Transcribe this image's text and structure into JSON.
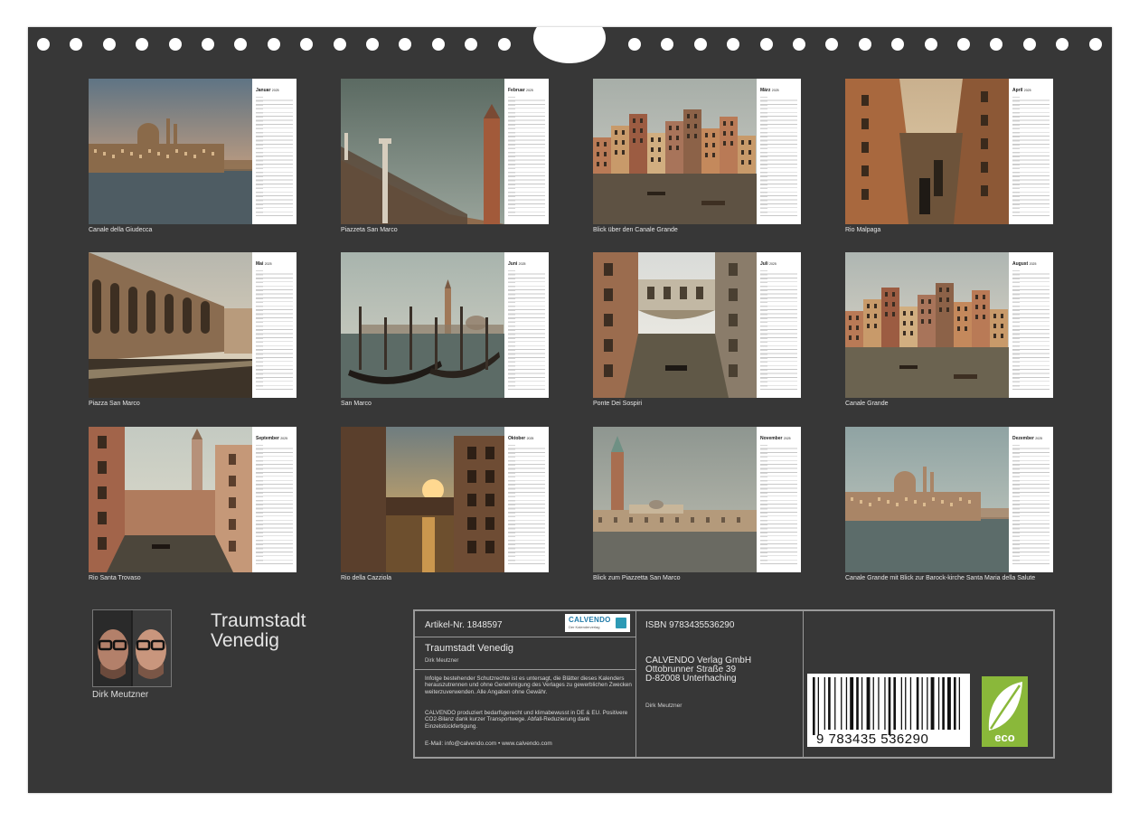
{
  "months": [
    {
      "name": "Januar",
      "year": "2025",
      "caption": "Canale della Giudecca",
      "scene": "domes-skyline",
      "palette": {
        "sky_top": "#5f7484",
        "sky_bottom": "#f2b27e",
        "main": "#8a6a4a",
        "water": "#4e5c63"
      }
    },
    {
      "name": "Februar",
      "year": "2025",
      "caption": "Piazzeta San Marco",
      "scene": "tower-column",
      "palette": {
        "sky_top": "#5b6a62",
        "sky_bottom": "#98a39a",
        "main": "#8f6b4d",
        "water": "#4f4a40"
      }
    },
    {
      "name": "März",
      "year": "2025",
      "caption": "Blick über den Canale Grande",
      "scene": "canal-wide",
      "palette": {
        "sky_top": "#a7aea8",
        "sky_bottom": "#cfcfc7",
        "main": "#b0724e",
        "water": "#5e5243"
      }
    },
    {
      "name": "April",
      "year": "2025",
      "caption": "Rio Malpaga",
      "scene": "narrow-canal",
      "palette": {
        "sky_top": "#c9b08e",
        "sky_bottom": "#e3cfaa",
        "main": "#a8683e",
        "water": "#6d533a"
      }
    },
    {
      "name": "Mai",
      "year": "2025",
      "caption": "Piazza San Marco",
      "scene": "arcade",
      "palette": {
        "sky_top": "#b7b7ae",
        "sky_bottom": "#e5d6bd",
        "main": "#8a6c50",
        "water": "#3d3328"
      }
    },
    {
      "name": "Juni",
      "year": "2025",
      "caption": "San Marco",
      "scene": "gondolas",
      "palette": {
        "sky_top": "#a8b4ad",
        "sky_bottom": "#d5d3c6",
        "main": "#7f6a55",
        "water": "#5c6b66"
      }
    },
    {
      "name": "Juli",
      "year": "2025",
      "caption": "Ponte Dei Sospiri",
      "scene": "bridge",
      "palette": {
        "sky_top": "#d9dbd8",
        "sky_bottom": "#f4f0e7",
        "main": "#9b6c4e",
        "water": "#605847"
      }
    },
    {
      "name": "August",
      "year": "2025",
      "caption": "Canale Grande",
      "scene": "canal-wide",
      "palette": {
        "sky_top": "#aeb6b2",
        "sky_bottom": "#e7dccb",
        "main": "#b17a55",
        "water": "#6b6350"
      }
    },
    {
      "name": "September",
      "year": "2025",
      "caption": "Rio Santa Trovaso",
      "scene": "tower-street",
      "palette": {
        "sky_top": "#c4cac2",
        "sky_bottom": "#e2ddcb",
        "main": "#a2644a",
        "water": "#4c463b"
      }
    },
    {
      "name": "Oktober",
      "year": "2025",
      "caption": "Rio della Cazziola",
      "scene": "sunset-alley",
      "palette": {
        "sky_top": "#6f7d80",
        "sky_bottom": "#f2b65c",
        "main": "#5a3f2c",
        "water": "#6d4f2e"
      }
    },
    {
      "name": "November",
      "year": "2025",
      "caption": "Blick zum Piazzetta San Marco",
      "scene": "lagoon",
      "palette": {
        "sky_top": "#8e9690",
        "sky_bottom": "#c0c0b3",
        "main": "#b49a7b",
        "water": "#6a6a62"
      }
    },
    {
      "name": "Dezember",
      "year": "2025",
      "caption": "Canale Grande mit Blick zur Barock-kirche Santa Maria della Salute",
      "scene": "domes-skyline",
      "palette": {
        "sky_top": "#8fa3a3",
        "sky_bottom": "#c9cdc2",
        "main": "#a98567",
        "water": "#5c6c6a"
      }
    }
  ],
  "author": {
    "name": "Dirk Meutzner"
  },
  "book": {
    "title_line1": "Traumstadt",
    "title_line2": "Venedig"
  },
  "info": {
    "article_label": "Artikel-Nr. 1848597",
    "logo_text": "CALVENDO",
    "logo_sub": "Der Kalenderverlag",
    "title": "Traumstadt Venedig",
    "author": "Dirk Meutzner",
    "legal1": "Infolge bestehender Schutzrechte ist es untersagt, die Blätter dieses Kalenders herauszutrennen und ohne Genehmigung des Verlages zu gewerblichen Zwecken weiterzuverwenden. Alle Angaben ohne Gewähr.",
    "legal2": "CALVENDO produziert bedarfsgerecht und klimabewusst in DE & EU. Positivere CO2-Bilanz dank kurzer Transportwege. Abfall-Reduzierung dank Einzelstückfertigung.",
    "contact": "E-Mail: info@calvendo.com • www.calvendo.com",
    "isbn": "ISBN 9783435536290",
    "publisher_name": "CALVENDO Verlag GmbH",
    "publisher_street": "Ottobrunner Straße 39",
    "publisher_city": "D-82008 Unterhaching",
    "publisher_author": "Dirk Meutzner",
    "barcode_digits": "9  783435  536290",
    "eco_label": "eco"
  },
  "colors": {
    "sheet": "#373737",
    "border": "#9a9a9a",
    "eco": "#8ab83a"
  }
}
